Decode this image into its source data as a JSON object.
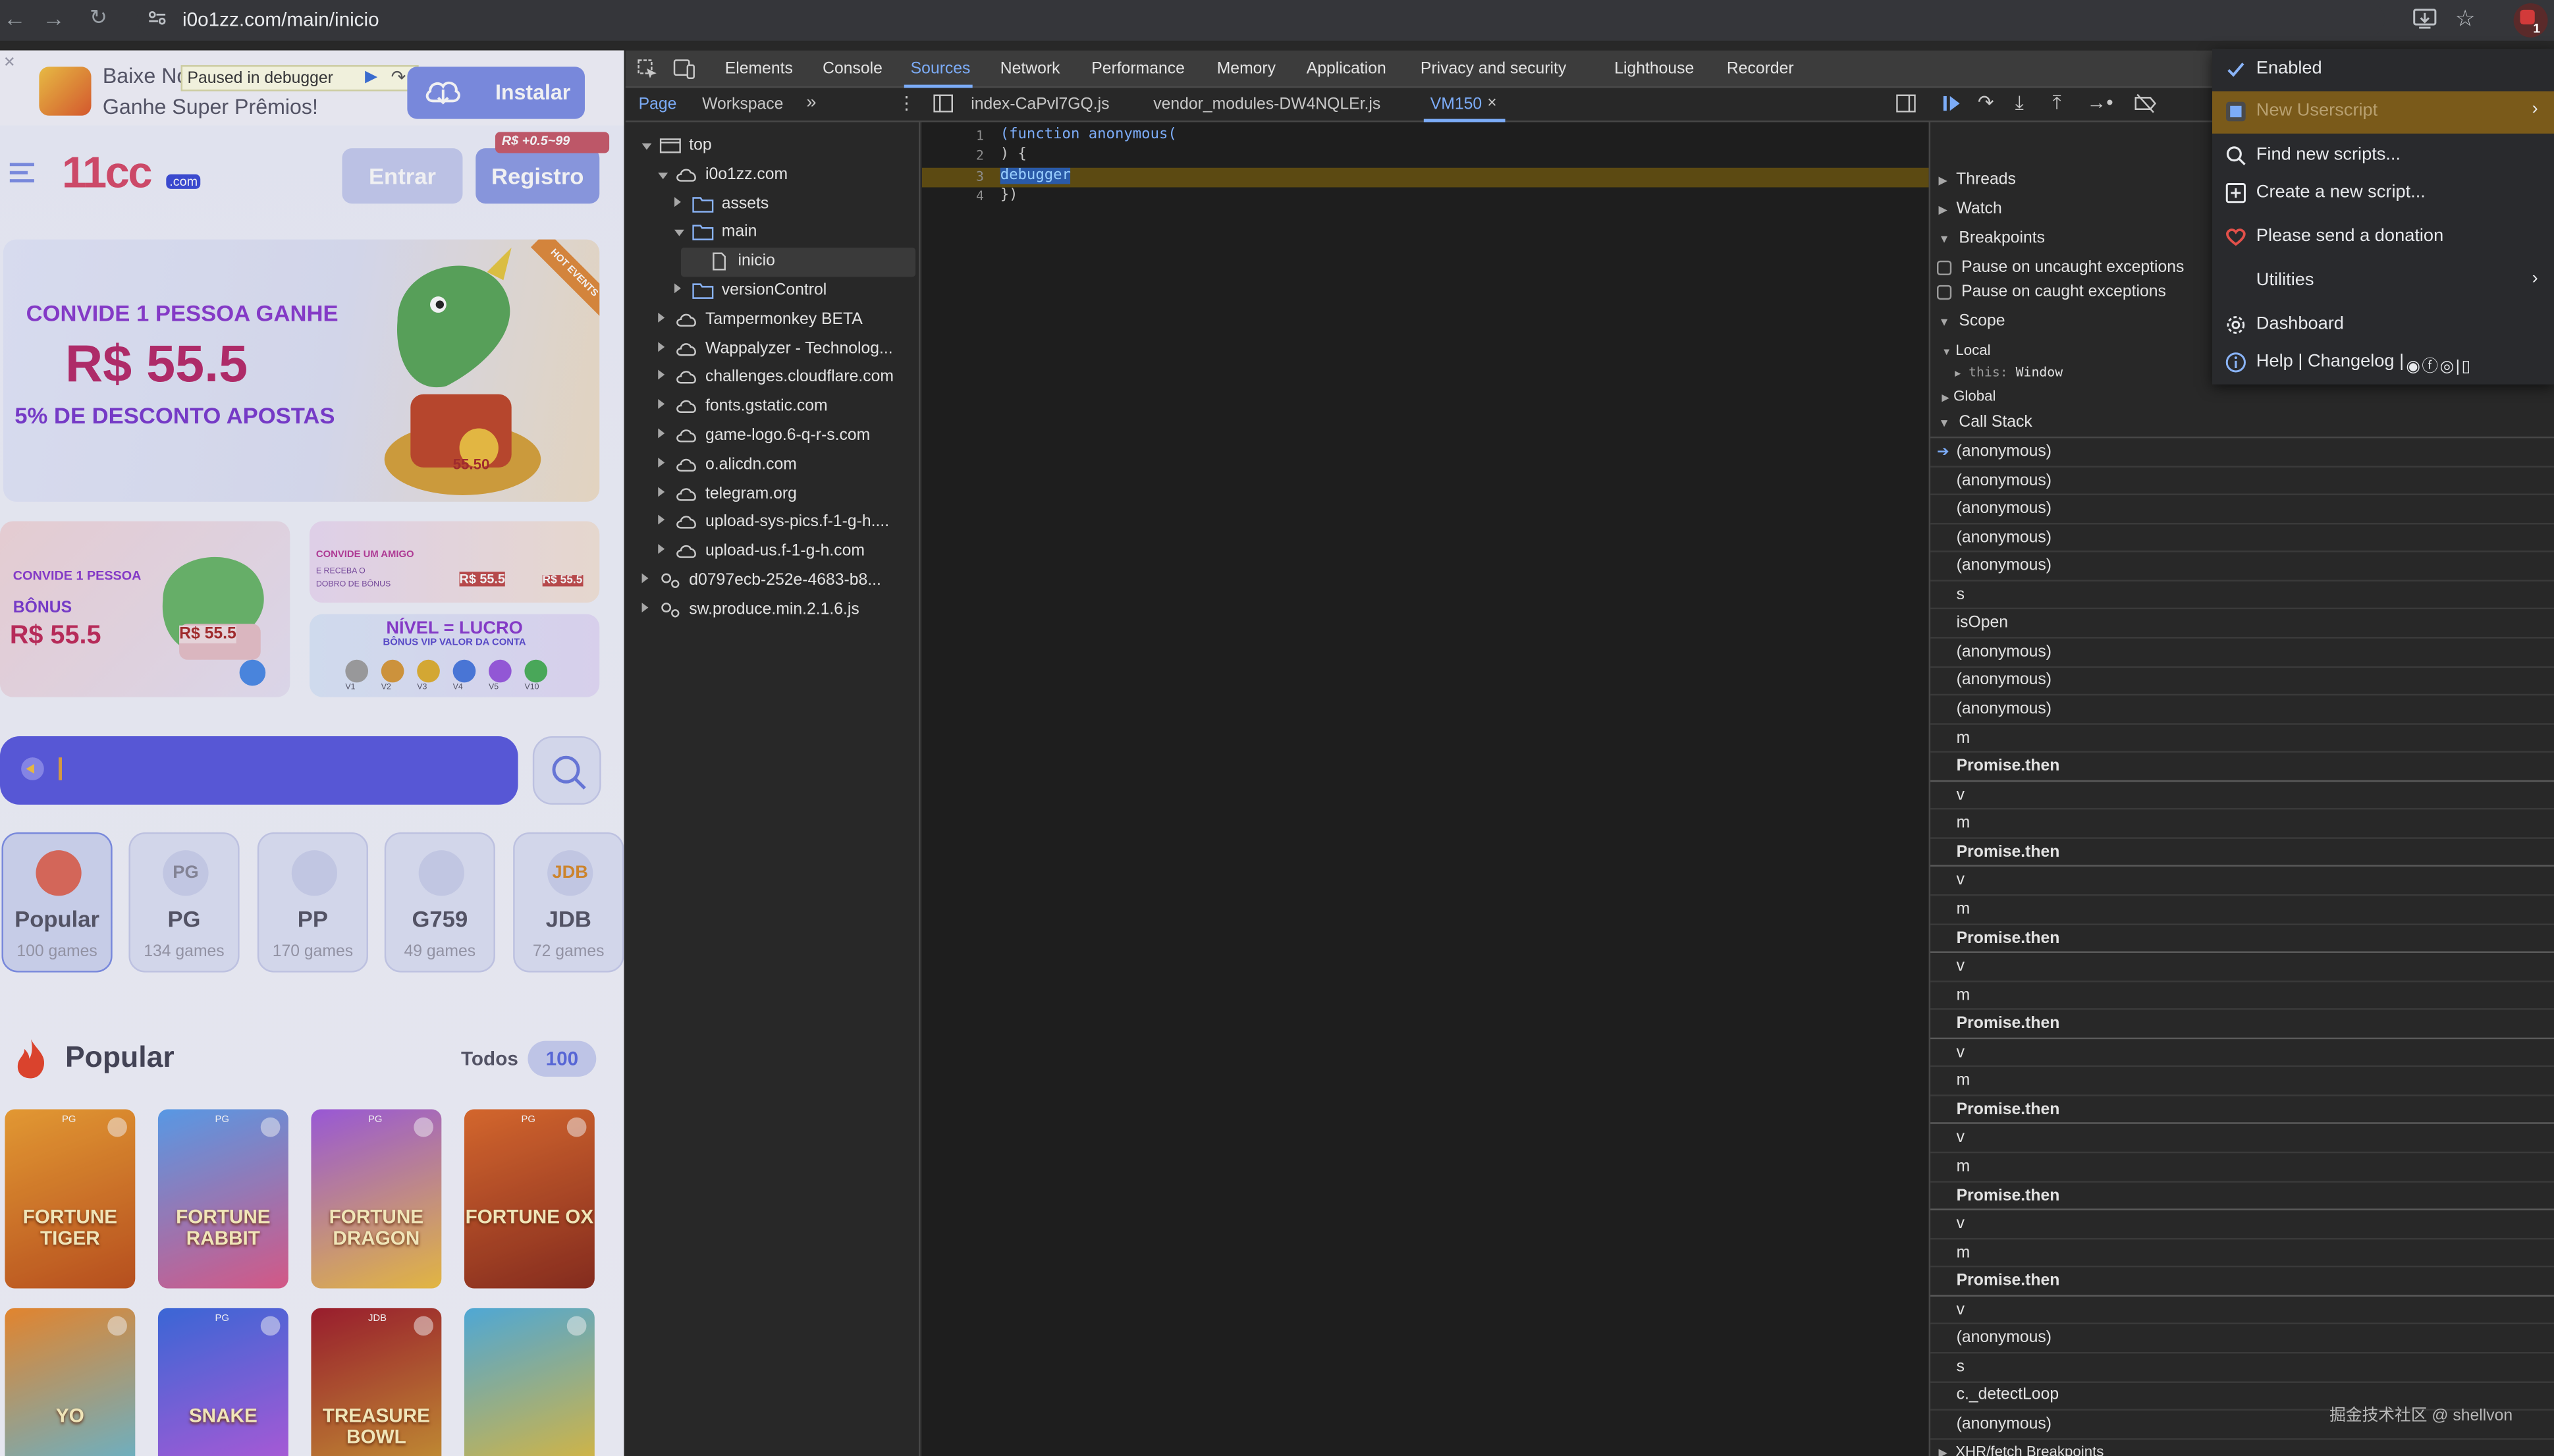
{
  "browser": {
    "url": "i0o1zz.com/main/inicio"
  },
  "website": {
    "install_banner": {
      "line1": "Baixe No",
      "line2": "Ganhe Super Prêmios!",
      "paused_label": "Paused in debugger",
      "install_button": "Instalar"
    },
    "header": {
      "logo_text": "11cc",
      "logo_suffix": ".com",
      "login_button": "Entrar",
      "register_button": "Registro",
      "register_badge_prefix": "R$",
      "register_badge": "+0.5~99"
    },
    "hero": {
      "line1": "CONVIDE 1 PESSOA GANHE",
      "amount": "R$ 55.5",
      "line3": "5% DE DESCONTO APOSTAS",
      "badge": "HOT EVENTS",
      "coin": "55.50"
    },
    "promo_left": {
      "line1": "CONVIDE 1 PESSOA",
      "line2": "BÔNUS",
      "amount": "R$ 55.5",
      "ticket": "R$ 55.5"
    },
    "promo_right_top": {
      "line1": "CONVIDE UM AMIGO",
      "line2": "E RECEBA O",
      "line3": "DOBRO DE BÔNUS",
      "val1": "R$ 55.5",
      "val2": "R$ 55.5"
    },
    "promo_right_bottom": {
      "line1": "NÍVEL = LUCRO",
      "line2": "BÔNUS VIP VALOR DA CONTA",
      "levels": [
        "V1",
        "V2",
        "V3",
        "V4",
        "V5",
        "V10"
      ]
    },
    "categories": [
      {
        "name": "Popular",
        "games": "100 games"
      },
      {
        "name": "PG",
        "games": "134 games",
        "icon_text": "PG"
      },
      {
        "name": "PP",
        "games": "170 games"
      },
      {
        "name": "G759",
        "games": "49 games"
      },
      {
        "name": "JDB",
        "games": "72 games",
        "icon_text": "JDB"
      }
    ],
    "popular_section": {
      "title": "Popular",
      "todos_label": "Todos",
      "count": "100"
    },
    "games": [
      {
        "name": "FORTUNE TIGER",
        "provider": "PG"
      },
      {
        "name": "FORTUNE RABBIT",
        "provider": "PG"
      },
      {
        "name": "FORTUNE DRAGON",
        "provider": "PG"
      },
      {
        "name": "FORTUNE OX",
        "provider": "PG"
      },
      {
        "name": "YO",
        "provider": ""
      },
      {
        "name": "SNAKE",
        "provider": "PG"
      },
      {
        "name": "TREASURE BOWL",
        "provider": "JDB"
      },
      {
        "name": "",
        "provider": ""
      }
    ]
  },
  "devtools": {
    "tabs": [
      "Elements",
      "Console",
      "Sources",
      "Network",
      "Performance",
      "Memory",
      "Application",
      "Privacy and security",
      "Lighthouse",
      "Recorder"
    ],
    "active_tab": "Sources",
    "navigator_tabs": [
      "Page",
      "Workspace"
    ],
    "open_files": [
      "index-CaPvl7GQ.js",
      "vendor_modules-DW4NQLEr.js",
      "VM150"
    ],
    "tree": [
      {
        "label": "top",
        "depth": 0,
        "type": "frame",
        "open": true
      },
      {
        "label": "i0o1zz.com",
        "depth": 1,
        "type": "cloud",
        "open": true
      },
      {
        "label": "assets",
        "depth": 2,
        "type": "folder",
        "open": false
      },
      {
        "label": "main",
        "depth": 2,
        "type": "folder",
        "open": true
      },
      {
        "label": "inicio",
        "depth": 3,
        "type": "file",
        "open": false,
        "selected": true
      },
      {
        "label": "versionControl",
        "depth": 2,
        "type": "folder",
        "open": false
      },
      {
        "label": "Tampermonkey BETA",
        "depth": 1,
        "type": "cloud",
        "open": false
      },
      {
        "label": "Wappalyzer - Technolog...",
        "depth": 1,
        "type": "cloud",
        "open": false
      },
      {
        "label": "challenges.cloudflare.com",
        "depth": 1,
        "type": "cloud",
        "open": false
      },
      {
        "label": "fonts.gstatic.com",
        "depth": 1,
        "type": "cloud",
        "open": false
      },
      {
        "label": "game-logo.6-q-r-s.com",
        "depth": 1,
        "type": "cloud",
        "open": false
      },
      {
        "label": "o.alicdn.com",
        "depth": 1,
        "type": "cloud",
        "open": false
      },
      {
        "label": "telegram.org",
        "depth": 1,
        "type": "cloud",
        "open": false
      },
      {
        "label": "upload-sys-pics.f-1-g-h....",
        "depth": 1,
        "type": "cloud",
        "open": false
      },
      {
        "label": "upload-us.f-1-g-h.com",
        "depth": 1,
        "type": "cloud",
        "open": false
      },
      {
        "label": "d0797ecb-252e-4683-b8...",
        "depth": 0,
        "type": "gear",
        "open": false
      },
      {
        "label": "sw.produce.min.2.1.6.js",
        "depth": 0,
        "type": "gear",
        "open": false
      }
    ],
    "code_lines": [
      {
        "n": "1",
        "text": "(function anonymous("
      },
      {
        "n": "2",
        "text": ") {"
      },
      {
        "n": "3",
        "text": "debugger"
      },
      {
        "n": "4",
        "text": "})"
      }
    ],
    "debugger": {
      "threads": "Threads",
      "watch": "Watch",
      "breakpoints": "Breakpoints",
      "pause_uncaught": "Pause on uncaught exceptions",
      "pause_caught": "Pause on caught exceptions",
      "scope": "Scope",
      "local": "Local",
      "this_key": "this",
      "this_val": "Window",
      "global": "Global",
      "call_stack": "Call Stack",
      "frames": [
        {
          "name": "(anonymous)",
          "async": false,
          "current": true
        },
        {
          "name": "(anonymous)",
          "async": false
        },
        {
          "name": "(anonymous)",
          "async": false
        },
        {
          "name": "(anonymous)",
          "async": false
        },
        {
          "name": "(anonymous)",
          "async": false
        },
        {
          "name": "s",
          "async": false
        },
        {
          "name": "isOpen",
          "async": false
        },
        {
          "name": "(anonymous)",
          "async": false
        },
        {
          "name": "(anonymous)",
          "async": false
        },
        {
          "name": "(anonymous)",
          "async": false
        },
        {
          "name": "m",
          "async": false
        },
        {
          "name": "Promise.then",
          "async": true
        },
        {
          "name": "v",
          "async": false
        },
        {
          "name": "m",
          "async": false
        },
        {
          "name": "Promise.then",
          "async": true
        },
        {
          "name": "v",
          "async": false
        },
        {
          "name": "m",
          "async": false
        },
        {
          "name": "Promise.then",
          "async": true
        },
        {
          "name": "v",
          "async": false
        },
        {
          "name": "m",
          "async": false
        },
        {
          "name": "Promise.then",
          "async": true
        },
        {
          "name": "v",
          "async": false
        },
        {
          "name": "m",
          "async": false
        },
        {
          "name": "Promise.then",
          "async": true
        },
        {
          "name": "v",
          "async": false
        },
        {
          "name": "m",
          "async": false
        },
        {
          "name": "Promise.then",
          "async": true
        },
        {
          "name": "v",
          "async": false
        },
        {
          "name": "m",
          "async": false
        },
        {
          "name": "Promise.then",
          "async": true
        },
        {
          "name": "v",
          "async": false
        },
        {
          "name": "(anonymous)",
          "async": false
        },
        {
          "name": "s",
          "async": false
        },
        {
          "name": "c._detectLoop",
          "async": false
        },
        {
          "name": "(anonymous)",
          "async": false
        }
      ],
      "xhr_breakpoints": "XHR/fetch Breakpoints"
    }
  },
  "extension_menu": {
    "items": [
      {
        "label": "Enabled",
        "icon": "check-icon"
      },
      {
        "label": "New Userscript",
        "icon": "userscript-icon",
        "highlighted": true
      },
      {
        "label": "Find new scripts...",
        "icon": "search-icon"
      },
      {
        "label": "Create a new script...",
        "icon": "plus-box-icon"
      },
      {
        "label": "Please send a donation",
        "icon": "heart-icon"
      },
      {
        "label": "Utilities",
        "icon": ""
      },
      {
        "label": "Dashboard",
        "icon": "gear-icon"
      },
      {
        "label": "Help | Changelog |",
        "icon": "info-icon"
      }
    ],
    "colors": {
      "highlight": "#7a5a1a",
      "heart": "#e2504a",
      "check": "#8ab4f8"
    }
  },
  "watermark": "掘金技术社区 @ shellvon",
  "badge_count": "1"
}
